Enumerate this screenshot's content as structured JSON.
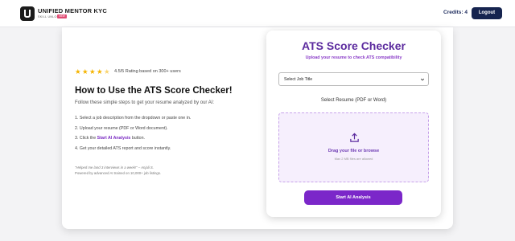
{
  "header": {
    "brand_name": "UNIFIED MENTOR KYC",
    "brand_tagline": "SKILL UNLOCKED",
    "brand_badge": "NEW",
    "credits_label": "Credits: 4",
    "logout_label": "Logout"
  },
  "intro": {
    "rating": 4.5,
    "rating_text": "4.5/5 Rating based on 300+ users",
    "title": "How to Use the ATS Score Checker!",
    "subtitle": "Follow these simple steps to get your resume analyzed by our AI:",
    "steps": {
      "s1": "1. Select a job description from the dropdown or paste one in.",
      "s2": "2. Upload your resume (PDF or Word document).",
      "s3_pre": "3. Click the ",
      "s3_highlight": "Start AI Analysis",
      "s3_post": " button.",
      "s4": "4. Get your detailed ATS report and score instantly."
    },
    "testimonial": "\"Helped me land 3 interviews in a week!\" – Anjali S.",
    "powered_by": "Powered by advanced AI trained on 10,000+ job listings."
  },
  "checker": {
    "title": "ATS Score Checker",
    "subtitle": "Upload your resume to check ATS compatibility",
    "job_select_value": "Select Job Title",
    "resume_label": "Select Resume (PDF or Word)",
    "dropzone_text": "Drag your file or browse",
    "dropzone_hint": "Max 2 MB files are allowed",
    "analyze_button": "Start AI Analysis"
  },
  "colors": {
    "primary_purple": "#7b27c9",
    "title_purple": "#5b2a9e",
    "navy": "#16244f",
    "star_gold": "#f5b400"
  },
  "icons": [
    "brand-logo",
    "star-icon",
    "chevron-down-icon",
    "upload-icon"
  ]
}
